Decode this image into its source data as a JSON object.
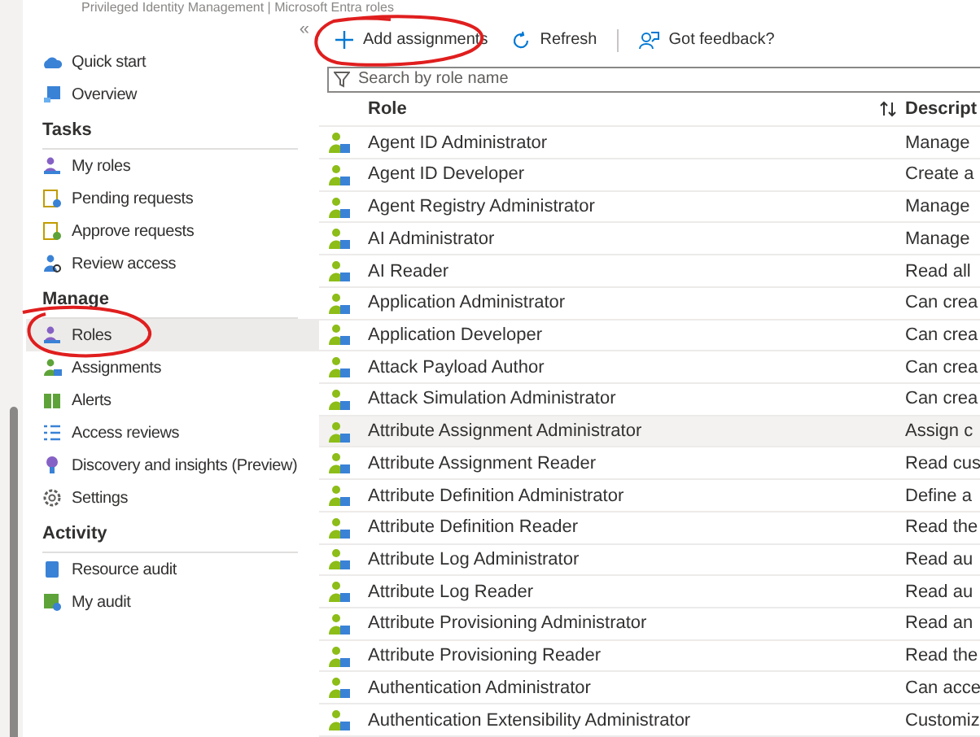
{
  "breadcrumb": "Privileged Identity Management | Microsoft Entra roles",
  "sidebar": {
    "collapse": "«",
    "sections": [
      {
        "items": [
          {
            "label": "Quick start",
            "selected": false
          },
          {
            "label": "Overview",
            "selected": false
          }
        ]
      },
      {
        "header": "Tasks",
        "items": [
          {
            "label": "My roles",
            "selected": false
          },
          {
            "label": "Pending requests",
            "selected": false
          },
          {
            "label": "Approve requests",
            "selected": false
          },
          {
            "label": "Review access",
            "selected": false
          }
        ]
      },
      {
        "header": "Manage",
        "items": [
          {
            "label": "Roles",
            "selected": true
          },
          {
            "label": "Assignments",
            "selected": false
          },
          {
            "label": "Alerts",
            "selected": false
          },
          {
            "label": "Access reviews",
            "selected": false
          },
          {
            "label": "Discovery and insights (Preview)",
            "selected": false
          },
          {
            "label": "Settings",
            "selected": false
          }
        ]
      },
      {
        "header": "Activity",
        "items": [
          {
            "label": "Resource audit",
            "selected": false
          },
          {
            "label": "My audit",
            "selected": false
          }
        ]
      }
    ]
  },
  "toolbar": [
    {
      "label": "Add assignments"
    },
    {
      "label": "Refresh"
    },
    {
      "label": "Got feedback?"
    }
  ],
  "search": {
    "placeholder": "Search by role name"
  },
  "table": {
    "columns": [
      "Role",
      "Descript"
    ],
    "rows": [
      {
        "role": "Agent ID Administrator",
        "description": "Manage",
        "hovered": false
      },
      {
        "role": "Agent ID Developer",
        "description": "Create a",
        "hovered": false
      },
      {
        "role": "Agent Registry Administrator",
        "description": "Manage",
        "hovered": false
      },
      {
        "role": "AI Administrator",
        "description": "Manage",
        "hovered": false
      },
      {
        "role": "AI Reader",
        "description": "Read all",
        "hovered": false
      },
      {
        "role": "Application Administrator",
        "description": "Can crea",
        "hovered": false
      },
      {
        "role": "Application Developer",
        "description": "Can crea",
        "hovered": false
      },
      {
        "role": "Attack Payload Author",
        "description": "Can crea",
        "hovered": false
      },
      {
        "role": "Attack Simulation Administrator",
        "description": "Can crea",
        "hovered": false
      },
      {
        "role": "Attribute Assignment Administrator",
        "description": "Assign c",
        "hovered": true
      },
      {
        "role": "Attribute Assignment Reader",
        "description": "Read cus",
        "hovered": false
      },
      {
        "role": "Attribute Definition Administrator",
        "description": "Define a",
        "hovered": false
      },
      {
        "role": "Attribute Definition Reader",
        "description": "Read the",
        "hovered": false
      },
      {
        "role": "Attribute Log Administrator",
        "description": "Read au",
        "hovered": false
      },
      {
        "role": "Attribute Log Reader",
        "description": "Read au",
        "hovered": false
      },
      {
        "role": "Attribute Provisioning Administrator",
        "description": "Read an",
        "hovered": false
      },
      {
        "role": "Attribute Provisioning Reader",
        "description": "Read the",
        "hovered": false
      },
      {
        "role": "Authentication Administrator",
        "description": "Can acce",
        "hovered": false
      },
      {
        "role": "Authentication Extensibility Administrator",
        "description": "Customiz",
        "hovered": false
      }
    ]
  }
}
